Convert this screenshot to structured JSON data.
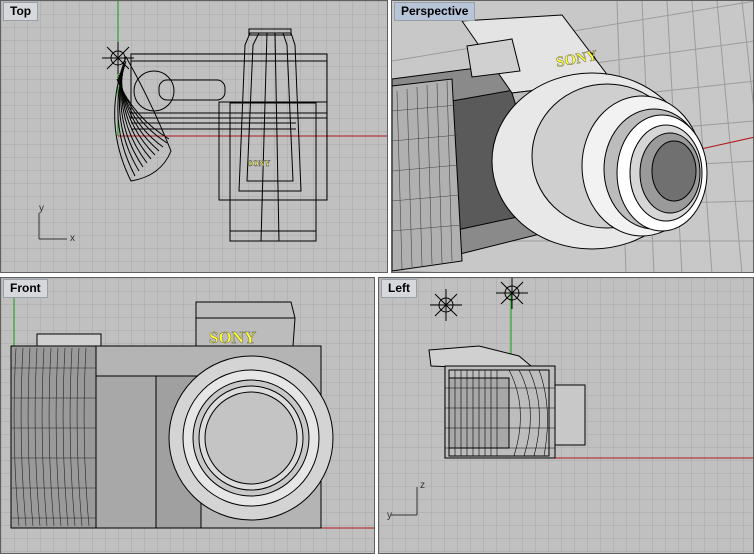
{
  "viewports": {
    "top": {
      "label": "Top",
      "axis_x": "x",
      "axis_y": "y"
    },
    "perspective": {
      "label": "Perspective"
    },
    "front": {
      "label": "Front"
    },
    "left": {
      "label": "Left",
      "axis_x": "y",
      "axis_y": "z"
    }
  },
  "model": {
    "brand_text": "SONY"
  },
  "colors": {
    "viewport_bg": "#c0c0c0",
    "grid_line": "#a8a8a8",
    "grid_major": "#8c8c8c",
    "x_axis": "#b01818",
    "y_axis": "#10a010",
    "wire": "#000000",
    "brand_text": "#ffff33",
    "label_bg": "#d6d8dc"
  },
  "icons": [
    "light-icon"
  ]
}
